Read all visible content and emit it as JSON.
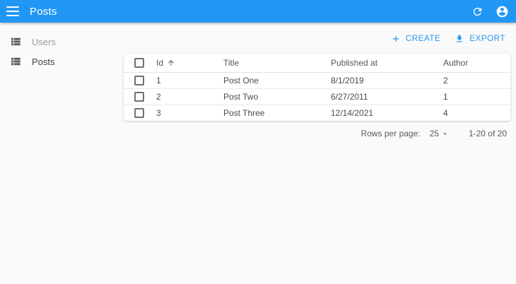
{
  "appbar": {
    "title": "Posts"
  },
  "sidebar": {
    "items": [
      {
        "label": "Users",
        "active": false
      },
      {
        "label": "Posts",
        "active": true
      }
    ]
  },
  "actions": {
    "create_label": "CREATE",
    "export_label": "EXPORT"
  },
  "table": {
    "columns": [
      "Id",
      "Title",
      "Published at",
      "Author"
    ],
    "sort": {
      "column": "Id",
      "direction": "ascending"
    },
    "rows": [
      {
        "id": "1",
        "title": "Post One",
        "published_at": "8/1/2019",
        "author": "2"
      },
      {
        "id": "2",
        "title": "Post Two",
        "published_at": "6/27/2011",
        "author": "1"
      },
      {
        "id": "3",
        "title": "Post Three",
        "published_at": "12/14/2021",
        "author": "4"
      }
    ]
  },
  "pagination": {
    "rows_per_page_label": "Rows per page:",
    "rows_per_page_value": "25",
    "range_label": "1-20 of 20"
  },
  "colors": {
    "primary": "#2196f3",
    "appbar_bg": "#2196f3",
    "page_bg": "#fafafa",
    "card_bg": "#ffffff"
  }
}
